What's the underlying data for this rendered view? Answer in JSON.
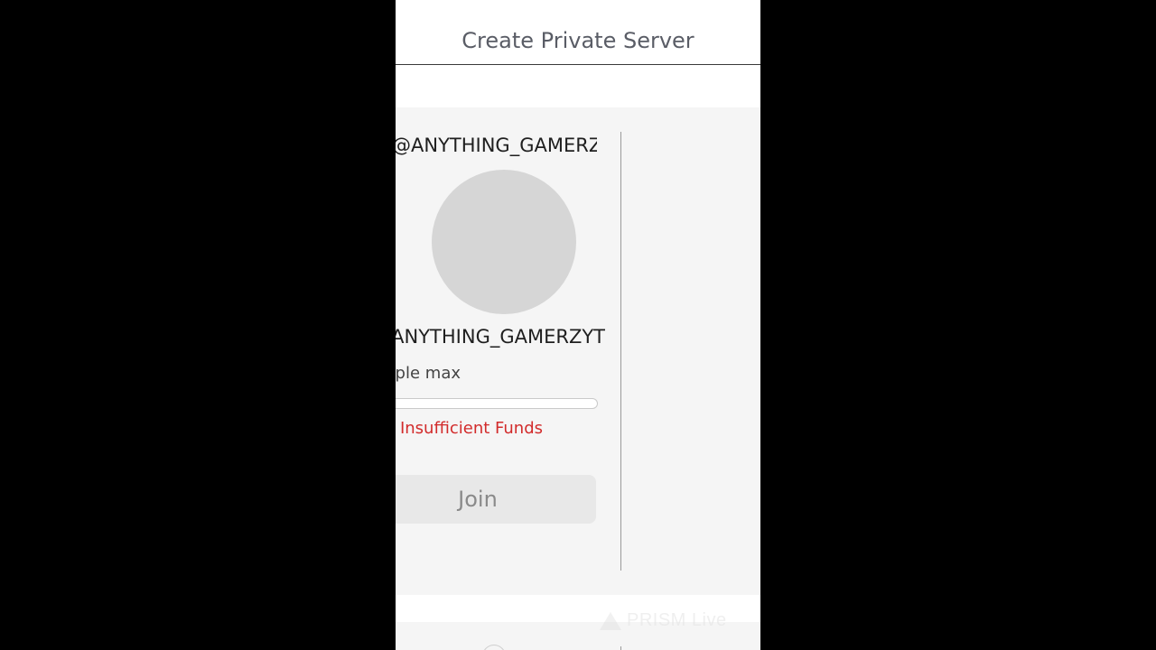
{
  "header": {
    "create_private_server_label": "Create Private Server"
  },
  "server_card": {
    "owner_handle": "@ANYTHING_GAMERZYT",
    "server_name": "ANYTHING_GAMERZYT",
    "players_text": "people max",
    "players_fill_fraction": 0,
    "error_message": "Insufficient Funds",
    "join_label": "Join",
    "avatar_icon": "avatar-placeholder-icon"
  },
  "watermark": {
    "text": "PRISM Live",
    "icon": "prism-triangle-icon"
  },
  "colors": {
    "background": "#000000",
    "panel": "#f5f5f5",
    "error": "#d22b2b",
    "join_disabled_bg": "#e8e8e8",
    "join_disabled_text": "#8a8a8a"
  }
}
